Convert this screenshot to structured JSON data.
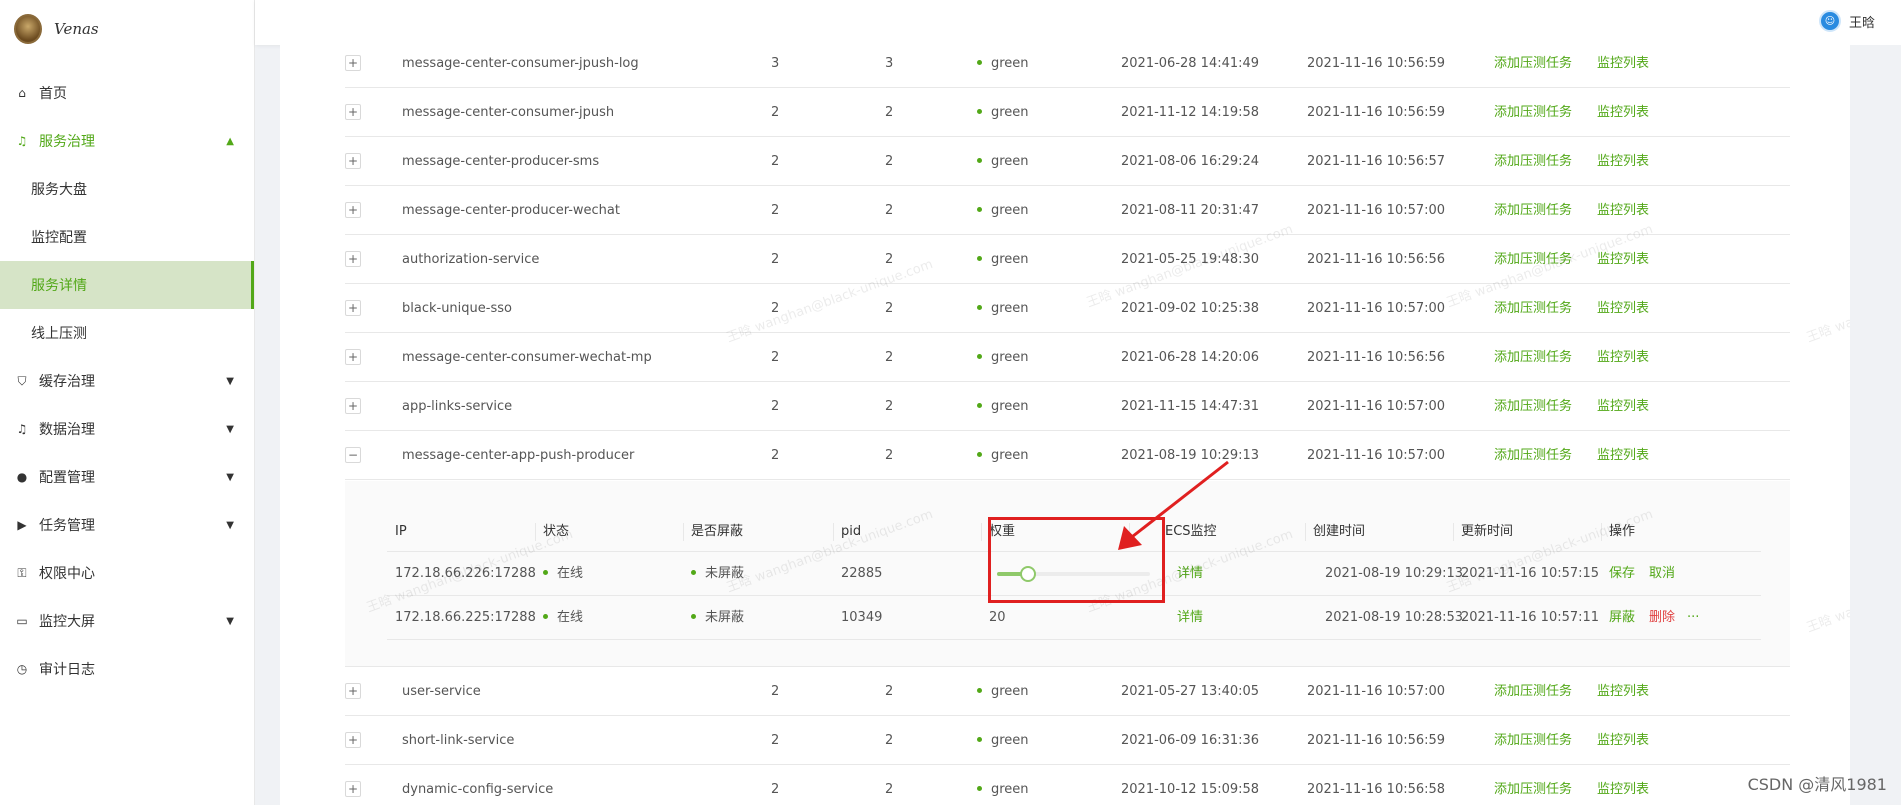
{
  "app": {
    "logo_text": "Venas"
  },
  "header": {
    "user_name": "王晗"
  },
  "sidebar": {
    "home": "首页",
    "service_gov": "服务治理",
    "sub": [
      "服务大盘",
      "监控配置",
      "服务详情",
      "线上压测"
    ],
    "cache_gov": "缓存治理",
    "data_gov": "数据治理",
    "config_mgmt": "配置管理",
    "task_mgmt": "任务管理",
    "perm_center": "权限中心",
    "monitor_screen": "监控大屏",
    "audit_log": "审计日志"
  },
  "actions": {
    "add_stress": "添加压测任务",
    "monitor_list": "监控列表"
  },
  "services_top": [
    {
      "expander": "+",
      "name": "message-center-consumer-jpush-log",
      "n1": "3",
      "n2": "3",
      "status": "green",
      "created": "2021-06-28 14:41:49",
      "updated": "2021-11-16 10:56:59"
    },
    {
      "expander": "+",
      "name": "message-center-consumer-jpush",
      "n1": "2",
      "n2": "2",
      "status": "green",
      "created": "2021-11-12 14:19:58",
      "updated": "2021-11-16 10:56:59"
    },
    {
      "expander": "+",
      "name": "message-center-producer-sms",
      "n1": "2",
      "n2": "2",
      "status": "green",
      "created": "2021-08-06 16:29:24",
      "updated": "2021-11-16 10:56:57"
    },
    {
      "expander": "+",
      "name": "message-center-producer-wechat",
      "n1": "2",
      "n2": "2",
      "status": "green",
      "created": "2021-08-11 20:31:47",
      "updated": "2021-11-16 10:57:00"
    },
    {
      "expander": "+",
      "name": "authorization-service",
      "n1": "2",
      "n2": "2",
      "status": "green",
      "created": "2021-05-25 19:48:30",
      "updated": "2021-11-16 10:56:56"
    },
    {
      "expander": "+",
      "name": "black-unique-sso",
      "n1": "2",
      "n2": "2",
      "status": "green",
      "created": "2021-09-02 10:25:38",
      "updated": "2021-11-16 10:57:00"
    },
    {
      "expander": "+",
      "name": "message-center-consumer-wechat-mp",
      "n1": "2",
      "n2": "2",
      "status": "green",
      "created": "2021-06-28 14:20:06",
      "updated": "2021-11-16 10:56:56"
    },
    {
      "expander": "+",
      "name": "app-links-service",
      "n1": "2",
      "n2": "2",
      "status": "green",
      "created": "2021-11-15 14:47:31",
      "updated": "2021-11-16 10:57:00"
    },
    {
      "expander": "−",
      "name": "message-center-app-push-producer",
      "n1": "2",
      "n2": "2",
      "status": "green",
      "created": "2021-08-19 10:29:13",
      "updated": "2021-11-16 10:57:00"
    }
  ],
  "services_bottom": [
    {
      "expander": "+",
      "name": "user-service",
      "n1": "2",
      "n2": "2",
      "status": "green",
      "created": "2021-05-27 13:40:05",
      "updated": "2021-11-16 10:57:00"
    },
    {
      "expander": "+",
      "name": "short-link-service",
      "n1": "2",
      "n2": "2",
      "status": "green",
      "created": "2021-06-09 16:31:36",
      "updated": "2021-11-16 10:56:59"
    },
    {
      "expander": "+",
      "name": "dynamic-config-service",
      "n1": "2",
      "n2": "2",
      "status": "green",
      "created": "2021-10-12 15:09:58",
      "updated": "2021-11-16 10:56:58"
    }
  ],
  "instances": {
    "headers": [
      "IP",
      "状态",
      "是否屏蔽",
      "pid",
      "权重",
      "ECS监控",
      "创建时间",
      "更新时间",
      "操作"
    ],
    "rows": [
      {
        "ip": "172.18.66.226:17288",
        "state": "在线",
        "shield": "未屏蔽",
        "pid": "22885",
        "weight_value": 0.2,
        "ecs": "详情",
        "created": "2021-08-19 10:29:13",
        "updated": "2021-11-16 10:57:15",
        "op1": "保存",
        "op2": "取消"
      },
      {
        "ip": "172.18.66.225:17288",
        "state": "在线",
        "shield": "未屏蔽",
        "pid": "10349",
        "weight": "20",
        "ecs": "详情",
        "created": "2021-08-19 10:28:53",
        "updated": "2021-11-16 10:57:11",
        "op1": "屏蔽",
        "op2": "删除",
        "op3": "···"
      }
    ]
  },
  "watermark": "王晗 wanghan@black-unique.com",
  "footer": {
    "csdn": "CSDN @清风1981"
  },
  "colors": {
    "accent": "#52a818",
    "danger": "#e04040",
    "highlight": "#e02020"
  }
}
